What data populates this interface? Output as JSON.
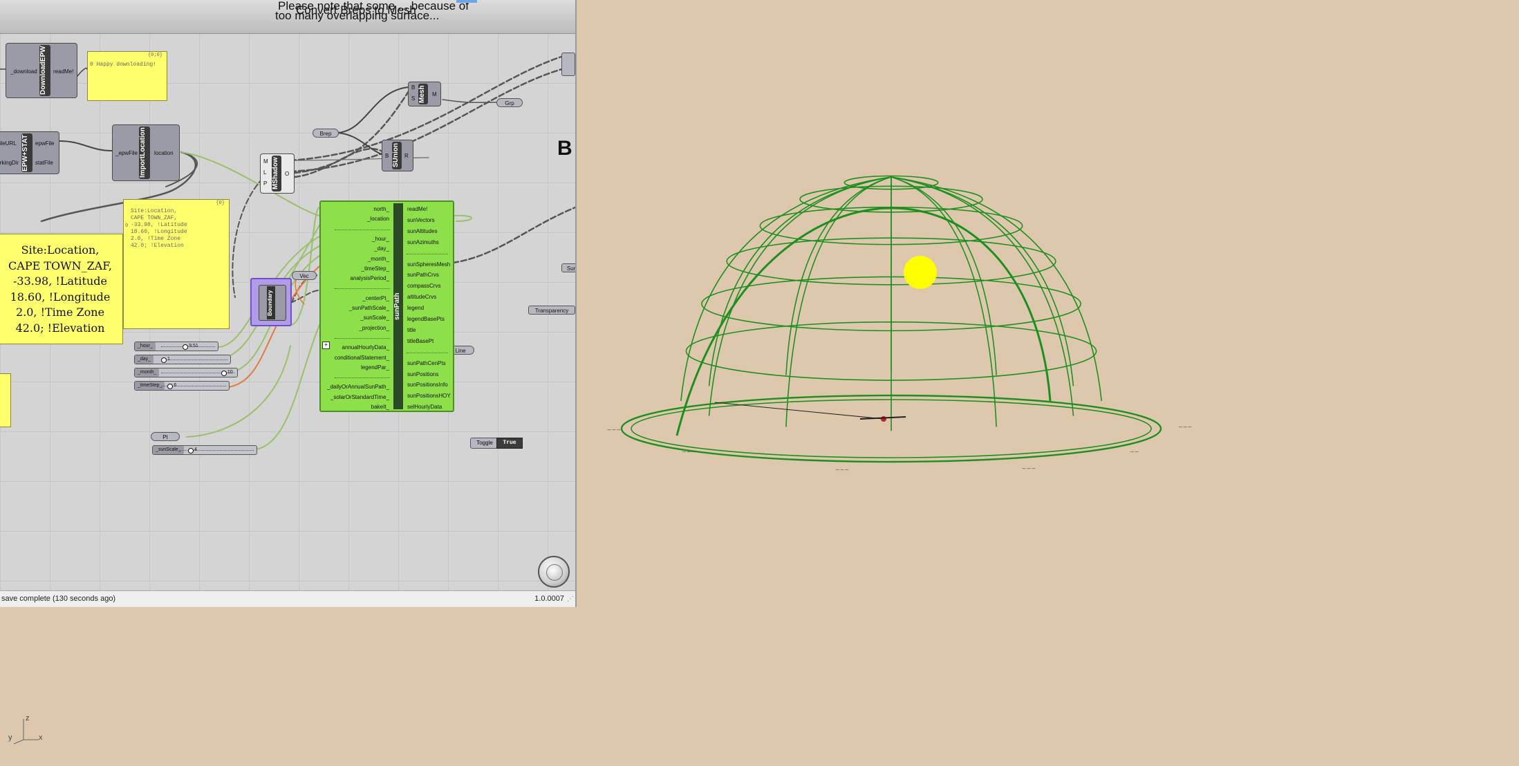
{
  "canvas": {
    "title_lines": [
      "Please note that some ... because of",
      "too many overlapping surface...",
      "Convert Breps to Mesh"
    ],
    "b_label": "B",
    "status": {
      "message": "save complete (130 seconds ago)",
      "version": "1.0.0007"
    }
  },
  "components": {
    "download_epw": {
      "title": "DownloadEPW",
      "input": "_download",
      "output": "readMe!"
    },
    "panel_download": {
      "header": "{0;0}",
      "text": "0 Happy downloading!"
    },
    "epw_stat": {
      "title": "EPW+STAT",
      "inputs": [
        "_fileURL",
        "_workingDir"
      ],
      "outputs": [
        "epwFile",
        "statFile"
      ]
    },
    "import_location": {
      "title": "ImportLocation",
      "input": "_epwFile",
      "output": "location"
    },
    "panel_location_small": {
      "header": "{0}",
      "index": "0",
      "lines": [
        "Site:Location,",
        "CAPE TOWN_ZAF,",
        "-33.98,     !Latitude",
        "18.60,     !Longitude",
        "2.0,      !Time Zone",
        "42.0;      !Elevation"
      ]
    },
    "panel_location_big": {
      "lines": [
        "Site:Location,",
        "CAPE TOWN_ZAF,",
        "-33.98,     !Latitude",
        "18.60,     !Longitude",
        "2.0,     !Time Zone",
        "42.0;      !Elevation"
      ]
    },
    "mshadow": {
      "title": "MShadow",
      "inputs": [
        "M",
        "L",
        "P"
      ],
      "output": "O"
    },
    "sunion": {
      "title": "SUnion",
      "input": "B",
      "output": "R"
    },
    "mesh": {
      "title": "Mesh",
      "inputs": [
        "B",
        "S"
      ],
      "output": "M"
    },
    "brep": {
      "label": "Brep"
    },
    "grp": {
      "label": "Grp"
    },
    "vec": {
      "label": "Vec"
    },
    "line": {
      "label": "Line"
    },
    "pt": {
      "label": "Pt"
    },
    "sun_lbl": {
      "label": "Sun"
    },
    "transparency": {
      "label": "Transparency"
    },
    "boundary": {
      "title": "Boundary"
    },
    "sunpath": {
      "title": "sunPath",
      "inputs": [
        "north_",
        "_location",
        "",
        "_hour_",
        "_day_",
        "_month_",
        "_timeStep_",
        "analysisPeriod_",
        "",
        "_centerPt_",
        "_sunPathScale_",
        "_sunScale_",
        "_projection_",
        "",
        "annualHourlyData_",
        "conditionalStatement_",
        "legendPar_",
        "",
        "_dailyOrAnnualSunPath_",
        "_solarOrStandardTime_",
        "bakeIt_"
      ],
      "outputs": [
        "readMe!",
        "sunVectors",
        "sunAltitudes",
        "sunAzimuths",
        "",
        "sunSpheresMesh",
        "sunPathCrvs",
        "compassCrvs",
        "altitudeCrvs",
        "legend",
        "legendBasePts",
        "title",
        "titleBasePt",
        "",
        "sunPathCenPts",
        "sunPositions",
        "sunPositionsInfo",
        "sunPositionsHOY",
        "selHourlyData"
      ],
      "add_icon": "+"
    },
    "sliders": [
      {
        "label": "_hour_",
        "value": "9.51",
        "fraction": 0.4
      },
      {
        "label": "_day_",
        "value": "1",
        "fraction": 0.0
      },
      {
        "label": "_month_",
        "value": "10",
        "fraction": 0.82
      },
      {
        "label": "_timeStep_",
        "value": "6",
        "fraction": 0.1
      },
      {
        "label": "_sunScale_",
        "value": "4",
        "fraction": 0.12
      }
    ],
    "toggle": {
      "label": "Toggle",
      "value": "True"
    }
  },
  "viewport": {
    "axis_labels": {
      "z": "z",
      "y": "y",
      "x": "x"
    },
    "colors": {
      "background": "#ddc8ae",
      "sunpath": "#1e8f1e",
      "sun": "#ffff00"
    }
  }
}
